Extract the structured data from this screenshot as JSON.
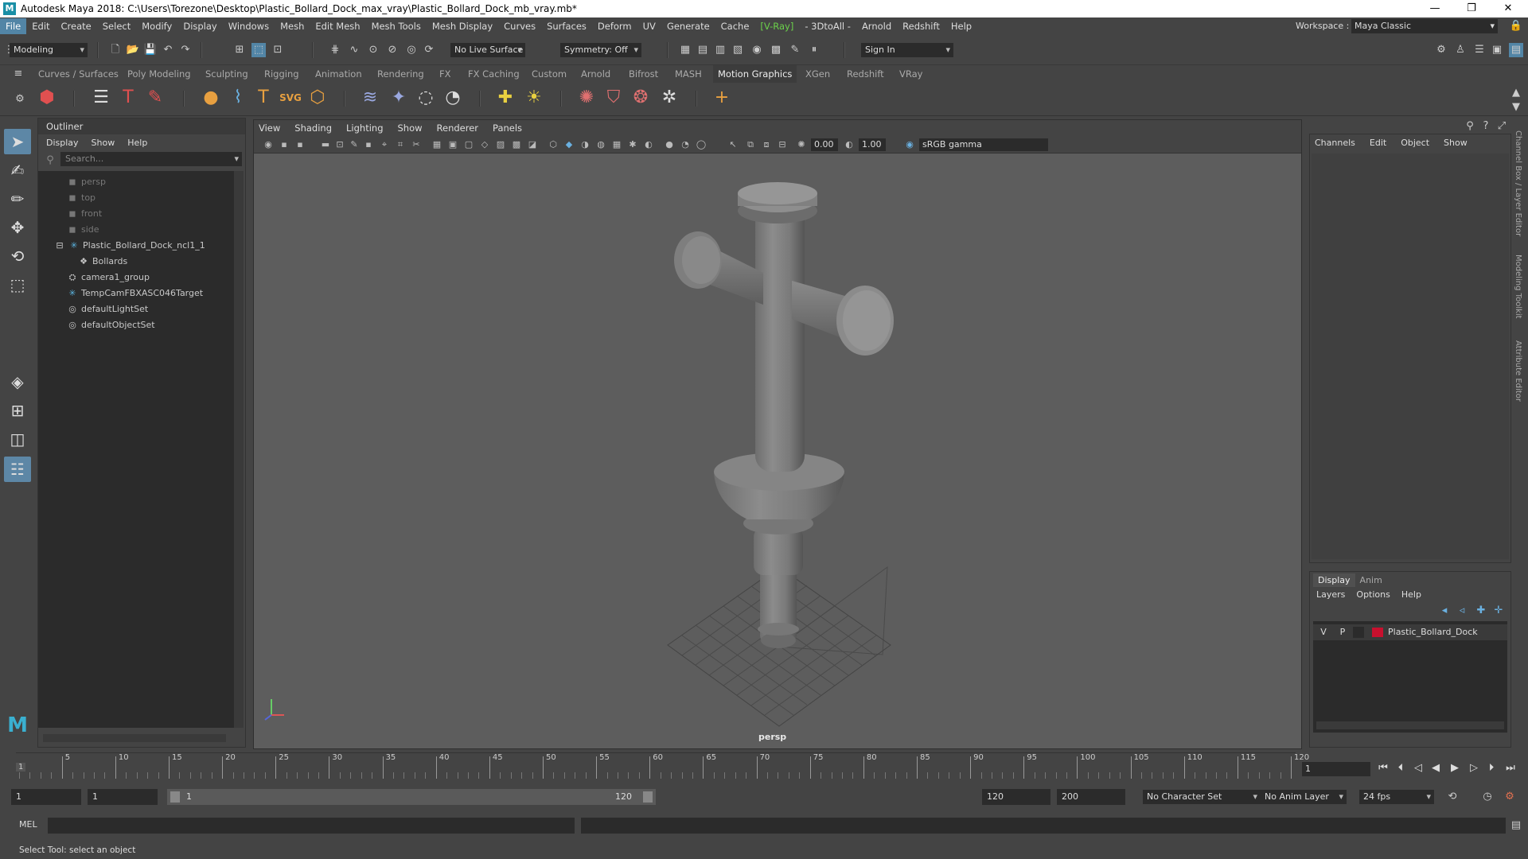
{
  "titlebar": {
    "title": "Autodesk Maya 2018: C:\\Users\\Torezone\\Desktop\\Plastic_Bollard_Dock_max_vray\\Plastic_Bollard_Dock_mb_vray.mb*",
    "logo": "M"
  },
  "menubar": {
    "items": [
      "File",
      "Edit",
      "Create",
      "Select",
      "Modify",
      "Display",
      "Windows",
      "Mesh",
      "Edit Mesh",
      "Mesh Tools",
      "Mesh Display",
      "Curves",
      "Surfaces",
      "Deform",
      "UV",
      "Generate",
      "Cache",
      "[V-Ray]",
      "- 3DtoAll -",
      "Arnold",
      "Redshift",
      "Help"
    ],
    "workspace_label": "Workspace :",
    "workspace_value": "Maya Classic"
  },
  "statusline": {
    "mode": "Modeling",
    "live_surface": "No Live Surface",
    "symmetry": "Symmetry: Off",
    "sign_in": "Sign In"
  },
  "shelf": {
    "tabs": [
      "Curves / Surfaces",
      "Poly Modeling",
      "Sculpting",
      "Rigging",
      "Animation",
      "Rendering",
      "FX",
      "FX Caching",
      "Custom",
      "Arnold",
      "Bifrost",
      "MASH",
      "Motion Graphics",
      "XGen",
      "Redshift",
      "VRay"
    ],
    "active_tab": "Motion Graphics"
  },
  "outliner": {
    "title": "Outliner",
    "menu": [
      "Display",
      "Show",
      "Help"
    ],
    "search_placeholder": "Search...",
    "nodes": [
      {
        "label": "persp",
        "icon": "camera-icon",
        "dim": true,
        "indent": 1
      },
      {
        "label": "top",
        "icon": "camera-icon",
        "dim": true,
        "indent": 1
      },
      {
        "label": "front",
        "icon": "camera-icon",
        "dim": true,
        "indent": 1
      },
      {
        "label": "side",
        "icon": "camera-icon",
        "dim": true,
        "indent": 1
      },
      {
        "label": "Plastic_Bollard_Dock_ncl1_1",
        "icon": "transform-icon",
        "dim": false,
        "indent": 1
      },
      {
        "label": "Bollards",
        "icon": "mesh-icon",
        "dim": false,
        "indent": 2
      },
      {
        "label": "camera1_group",
        "icon": "group-icon",
        "dim": false,
        "indent": 1
      },
      {
        "label": "TempCamFBXASC046Target",
        "icon": "transform-icon",
        "dim": false,
        "indent": 1
      },
      {
        "label": "defaultLightSet",
        "icon": "set-icon",
        "dim": false,
        "indent": 1
      },
      {
        "label": "defaultObjectSet",
        "icon": "set-icon",
        "dim": false,
        "indent": 1
      }
    ]
  },
  "viewport": {
    "menu": [
      "View",
      "Shading",
      "Lighting",
      "Show",
      "Renderer",
      "Panels"
    ],
    "exposure": "0.00",
    "gamma": "1.00",
    "color_space": "sRGB gamma",
    "camera_label": "persp"
  },
  "channelbox": {
    "menu": [
      "Channels",
      "Edit",
      "Object",
      "Show"
    ]
  },
  "side_tabs": [
    "Channel Box / Layer Editor",
    "Modeling Toolkit",
    "Attribute Editor"
  ],
  "layers": {
    "tabs": [
      "Display",
      "Anim"
    ],
    "menu": [
      "Layers",
      "Options",
      "Help"
    ],
    "layer": {
      "v": "V",
      "p": "P",
      "name": "Plastic_Bollard_Dock",
      "color": "#c8102e"
    }
  },
  "timeline": {
    "ticks": [
      "5",
      "10",
      "15",
      "20",
      "25",
      "30",
      "35",
      "40",
      "45",
      "50",
      "55",
      "60",
      "65",
      "70",
      "75",
      "80",
      "85",
      "90",
      "95",
      "100",
      "105",
      "110",
      "115",
      "120"
    ],
    "current_frame_marker": "1",
    "current_frame": "1"
  },
  "range": {
    "start": "1",
    "playback_start": "1",
    "slider_start": "1",
    "slider_end": "120",
    "playback_end": "120",
    "end": "200",
    "character_set": "No Character Set",
    "anim_layer": "No Anim Layer",
    "fps": "24 fps"
  },
  "cmdline": {
    "label": "MEL"
  },
  "help": {
    "text": "Select Tool: select an object"
  },
  "colors": {
    "accent": "#5285a6",
    "vray_green": "#6bd14a",
    "layer_red": "#c8102e"
  }
}
